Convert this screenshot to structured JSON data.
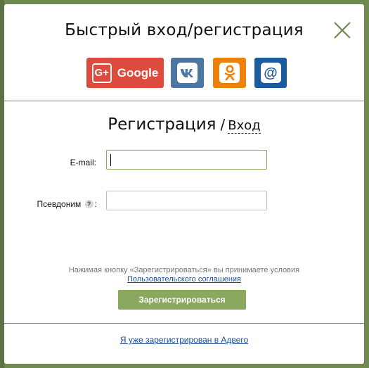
{
  "dialog": {
    "title": "Быстрый вход/регистрация"
  },
  "social": {
    "google": {
      "icon": "G+",
      "label": "Google",
      "color": "#dd4b3e"
    },
    "vk": {
      "icon": "vk-icon",
      "color": "#4d75a3"
    },
    "ok": {
      "icon": "odnoklassniki-icon",
      "color": "#ee8208"
    },
    "mail": {
      "icon": "@",
      "color": "#1e5aa0"
    }
  },
  "form": {
    "title_register": "Регистрация",
    "separator": "/",
    "title_login": "Вход",
    "email_label": "E-mail:",
    "email_value": "",
    "nickname_label": "Псевдоним",
    "nickname_help": "?",
    "nickname_colon": ":",
    "nickname_value": ""
  },
  "terms": {
    "text": "Нажимая кнопку «Зарегистрироваться» вы принимаете условия",
    "link": "Пользовательского соглашения"
  },
  "submit_label": "Зарегистрироваться",
  "footer_link": "Я уже зарегистрирован в Адвего",
  "colors": {
    "accent": "#8aa85e",
    "overlay": "#6f8a50",
    "link": "#1a4fa0"
  }
}
